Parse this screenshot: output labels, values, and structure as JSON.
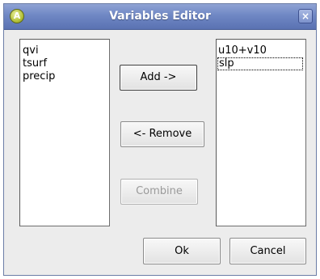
{
  "window": {
    "title": "Variables Editor",
    "app_icon_letter": "A",
    "close_glyph": "×"
  },
  "available_list": {
    "items": [
      "qvi",
      "tsurf",
      "precip"
    ]
  },
  "selected_list": {
    "items": [
      "u10+v10",
      "slp"
    ],
    "focused_item": "slp"
  },
  "buttons": {
    "add": "Add ->",
    "remove": "<- Remove",
    "combine": "Combine",
    "ok": "Ok",
    "cancel": "Cancel"
  },
  "button_states": {
    "combine_enabled": false
  },
  "icons": {
    "app": "app-icon",
    "close": "close-icon"
  },
  "colors": {
    "titlebar": "#6f87c4",
    "window_bg": "#ececec",
    "disabled_text": "#9a9a9a"
  }
}
